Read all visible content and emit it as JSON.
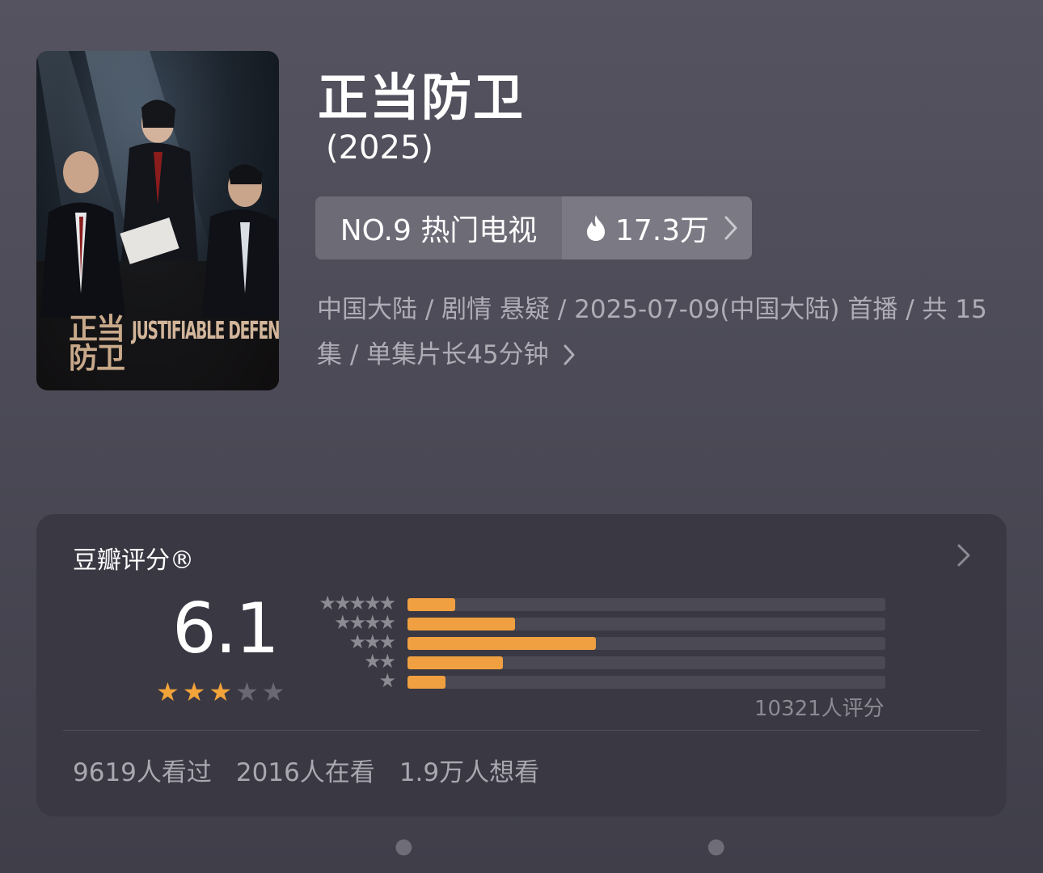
{
  "show": {
    "title": "正当防卫",
    "year": "(2025)",
    "poster": {
      "title_cn": "正当防卫",
      "title_en": "JUSTIFIABLE DEFENSE"
    }
  },
  "rank": {
    "label": "NO.9 热门电视",
    "heat": "17.3万",
    "icon": "flame-icon"
  },
  "meta": {
    "text": "中国大陆 / 剧情 悬疑 / 2025-07-09(中国大陆) 首播 / 共 15集 / 单集片长45分钟"
  },
  "rating": {
    "title": "豆瓣评分®",
    "score": "6.1",
    "stars": 3,
    "star_max": 5,
    "count": "10321人评分",
    "distribution": [
      {
        "stars": 5,
        "percent": 10
      },
      {
        "stars": 4,
        "percent": 22.5
      },
      {
        "stars": 3,
        "percent": 39.5
      },
      {
        "stars": 2,
        "percent": 20
      },
      {
        "stars": 1,
        "percent": 8
      }
    ],
    "stats": {
      "watched": "9619人看过",
      "watching": "2016人在看",
      "want": "1.9万人想看"
    }
  },
  "colors": {
    "accent": "#f0a040",
    "card": "#393843",
    "background": "#4b4a56"
  }
}
